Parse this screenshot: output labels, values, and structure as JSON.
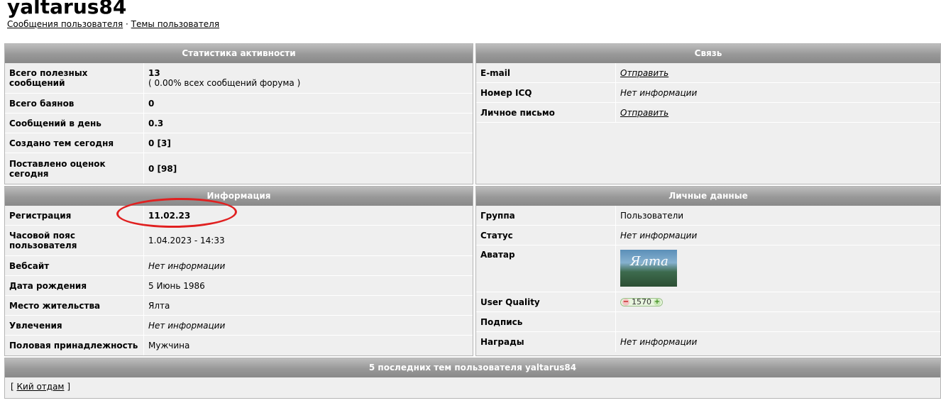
{
  "user": {
    "name": "yaltarus84",
    "links": [
      "Сообщения пользователя",
      "Темы пользователя"
    ],
    "separator": "·"
  },
  "activity": {
    "title": "Статистика активности",
    "rows": [
      {
        "label": "Всего полезных сообщений",
        "value": "13",
        "sub": "( 0.00% всех сообщений форума )"
      },
      {
        "label": "Всего баянов",
        "value": "0"
      },
      {
        "label": "Сообщений в день",
        "value": "0.3"
      },
      {
        "label": "Создано тем сегодня",
        "value": "0 [3]"
      },
      {
        "label": "Поставлено оценок сегодня",
        "value": "0 [98]"
      }
    ]
  },
  "contact": {
    "title": "Связь",
    "rows": [
      {
        "label": "E-mail",
        "value": "Отправить"
      },
      {
        "label": "Номер ICQ",
        "value": "Нет информации"
      },
      {
        "label": "Личное письмо",
        "value": "Отправить"
      }
    ]
  },
  "info": {
    "title": "Информация",
    "rows": [
      {
        "label": "Регистрация",
        "value": "11.02.23"
      },
      {
        "label": "Часовой пояс пользователя",
        "value": "1.04.2023 - 14:33"
      },
      {
        "label": "Вебсайт",
        "value": "Нет информации"
      },
      {
        "label": "Дата рождения",
        "value": "5 Июнь 1986"
      },
      {
        "label": "Место жительства",
        "value": "Ялта"
      },
      {
        "label": "Увлечения",
        "value": "Нет информации"
      },
      {
        "label": "Половая принадлежность",
        "value": "Мужчина"
      }
    ]
  },
  "personal": {
    "title": "Личные данные",
    "rows": [
      {
        "label": "Группа",
        "value": "Пользователи"
      },
      {
        "label": "Статус",
        "value": "Нет информации"
      },
      {
        "label": "Аватар",
        "value": ""
      },
      {
        "label": "User Quality",
        "value": "1570"
      },
      {
        "label": "Подпись",
        "value": ""
      },
      {
        "label": "Награды",
        "value": "Нет информации"
      }
    ],
    "avatar_text": "Ялта",
    "quality_minus": "−",
    "quality_plus": "+"
  },
  "topics": {
    "title": "5 последних тем пользователя yaltarus84",
    "bracket_open": "[",
    "bracket_close": "]",
    "items": [
      "Кий отдам"
    ]
  },
  "colors": {
    "header_gradient_top": "#bdbdbd",
    "header_gradient_bottom": "#8a8a8a",
    "panel_bg": "#efefef",
    "highlight_red": "#e02020"
  }
}
